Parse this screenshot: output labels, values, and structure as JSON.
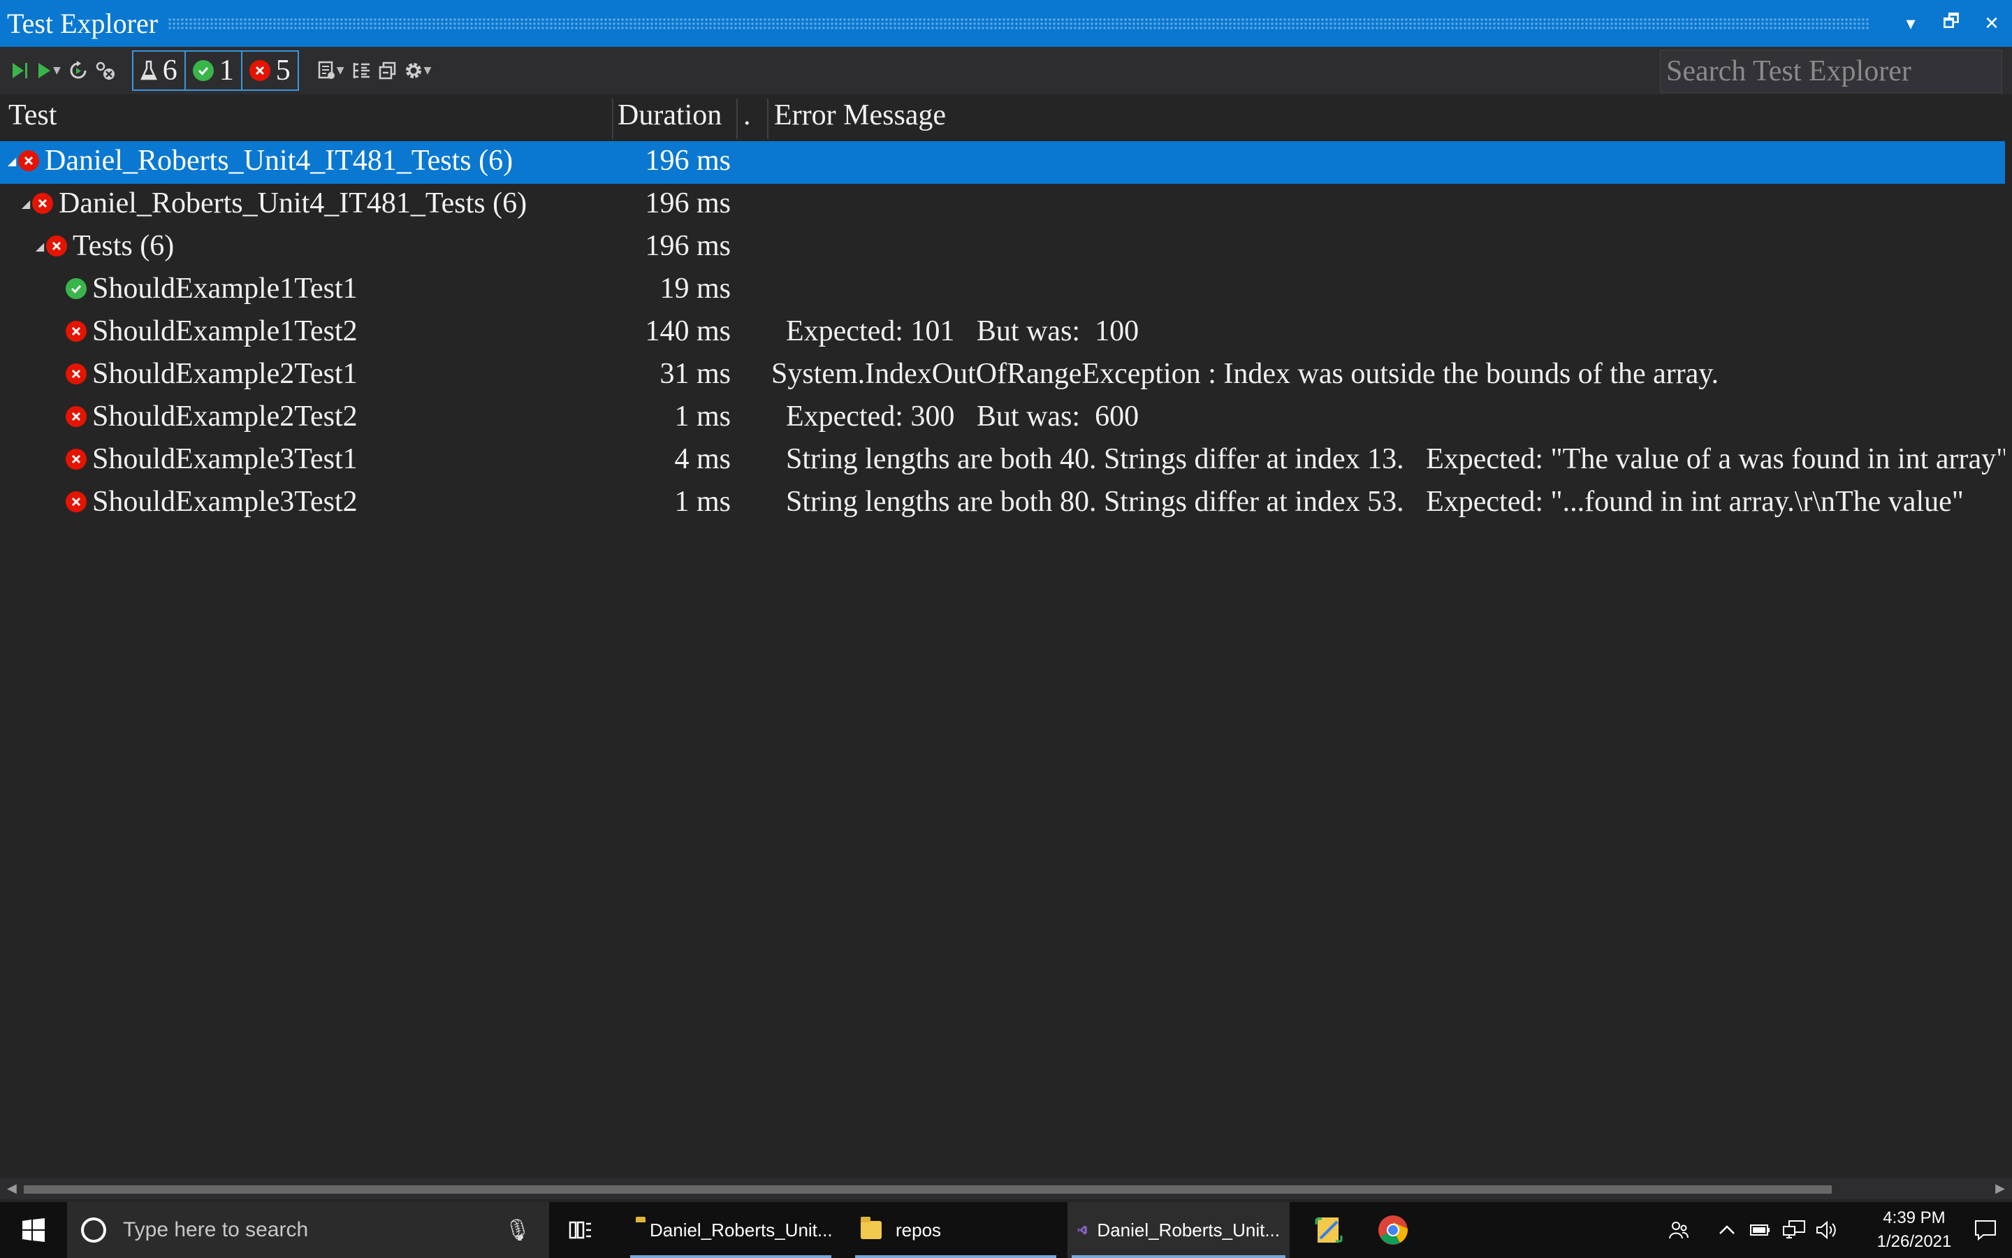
{
  "window": {
    "title": "Test Explorer",
    "controls": [
      "▾",
      "🗗",
      "✕"
    ]
  },
  "toolbar": {
    "counters": {
      "total": "6",
      "passed": "1",
      "failed": "5"
    },
    "search_placeholder": "Search Test Explorer"
  },
  "columns": {
    "test": "Test",
    "duration": "Duration",
    "dot": ".",
    "error": "Error Message"
  },
  "rows": [
    {
      "name": "Daniel_Roberts_Unit4_IT481_Tests (6)",
      "duration": "196 ms",
      "error": "",
      "status": "fail"
    },
    {
      "name": "Daniel_Roberts_Unit4_IT481_Tests (6)",
      "duration": "196 ms",
      "error": "",
      "status": "fail"
    },
    {
      "name": "Tests (6)",
      "duration": "196 ms",
      "error": "",
      "status": "fail"
    },
    {
      "name": "ShouldExample1Test1",
      "duration": "19 ms",
      "error": "",
      "status": "pass"
    },
    {
      "name": "ShouldExample1Test2",
      "duration": "140 ms",
      "error": "  Expected: 101   But was:  100",
      "status": "fail"
    },
    {
      "name": "ShouldExample2Test1",
      "duration": "31 ms",
      "error": "System.IndexOutOfRangeException : Index was outside the bounds of the array.",
      "status": "fail"
    },
    {
      "name": "ShouldExample2Test2",
      "duration": "1 ms",
      "error": "  Expected: 300   But was:  600",
      "status": "fail"
    },
    {
      "name": "ShouldExample3Test1",
      "duration": "4 ms",
      "error": "  String lengths are both 40. Strings differ at index 13.   Expected: \"The value of a was found in int array\"",
      "status": "fail"
    },
    {
      "name": "ShouldExample3Test2",
      "duration": "1 ms",
      "error": "  String lengths are both 80. Strings differ at index 53.   Expected: \"...found in int array.\\r\\nThe value\"",
      "status": "fail"
    }
  ],
  "taskbar": {
    "search_placeholder": "Type here to search",
    "apps": [
      {
        "label": "Daniel_Roberts_Unit..."
      },
      {
        "label": "repos"
      },
      {
        "label": "Daniel_Roberts_Unit..."
      }
    ],
    "time": "4:39 PM",
    "date": "1/26/2021"
  }
}
